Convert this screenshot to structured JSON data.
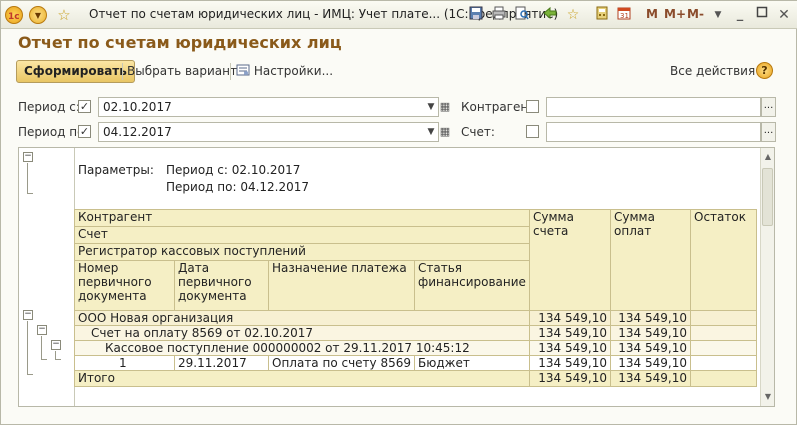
{
  "window": {
    "title": "Отчет по счетам юридических лиц - ИМЦ: Учет плате... (1С:Предприятие)",
    "mem_buttons": [
      "M",
      "M+",
      "M-"
    ]
  },
  "document": {
    "title": "Отчет по счетам юридических лиц"
  },
  "toolbar": {
    "generate_label": "Сформировать",
    "choose_variant_label": "Выбрать вариант...",
    "settings_label": "Настройки...",
    "all_actions_label": "Все действия",
    "help_label": "?"
  },
  "filters": {
    "period_from_label": "Период с:",
    "period_from_value": "02.10.2017",
    "period_to_label": "Период по:",
    "period_to_value": "04.12.2017",
    "counterparty_label": "Контрагент:",
    "counterparty_value": "",
    "account_label": "Счет:",
    "account_value": "",
    "dots": "..."
  },
  "report": {
    "params_label": "Параметры:",
    "param_from": "Период с: 02.10.2017",
    "param_to": "Период по: 04.12.2017",
    "headers": {
      "counterparty": "Контрагент",
      "account": "Счет",
      "registrar": "Регистратор кассовых поступлений",
      "doc_number": "Номер первичного документа",
      "doc_date": "Дата первичного документа",
      "purpose": "Назначение платежа",
      "item": "Статья финансирование",
      "sum_account": "Сумма счета",
      "sum_paid": "Сумма оплат",
      "balance": "Остаток"
    },
    "rows": {
      "org": {
        "name": "ООО Новая организация",
        "sum_account": "134 549,10",
        "sum_paid": "134 549,10",
        "balance": ""
      },
      "invoice": {
        "name": "Счет на оплату 8569 от 02.10.2017",
        "sum_account": "134 549,10",
        "sum_paid": "134 549,10",
        "balance": ""
      },
      "cash": {
        "name": "Кассовое поступление 000000002 от 29.11.2017 10:45:12",
        "sum_account": "134 549,10",
        "sum_paid": "134 549,10",
        "balance": ""
      },
      "detail": {
        "num": "1",
        "date": "29.11.2017",
        "purpose": "Оплата по счету 8569",
        "item": "Бюджет",
        "sum_account": "134 549,10",
        "sum_paid": "134 549,10",
        "balance": ""
      }
    },
    "total": {
      "label": "Итого",
      "sum_account": "134 549,10",
      "sum_paid": "134 549,10",
      "balance": ""
    }
  }
}
